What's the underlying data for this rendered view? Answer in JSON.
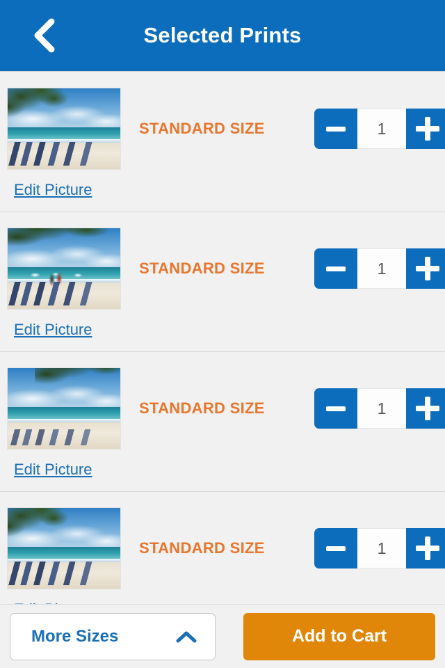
{
  "header": {
    "title": "Selected Prints",
    "back_icon": "chevron-left-icon",
    "background_color": "#0c6dbc"
  },
  "colors": {
    "header_blue": "#0c6dbc",
    "accent_orange": "#e8762c",
    "cart_orange": "#e08609",
    "link_blue": "#1a6fb5",
    "page_background": "#f1f1f1"
  },
  "prints": [
    {
      "size_label": "STANDARD SIZE",
      "quantity": "1",
      "edit_label": "Edit Picture",
      "minus_icon": "minus-icon",
      "plus_icon": "plus-icon",
      "thumbnail_alt": "beach with palm tree shade and blue lounge chairs"
    },
    {
      "size_label": "STANDARD SIZE",
      "quantity": "1",
      "edit_label": "Edit Picture",
      "minus_icon": "minus-icon",
      "plus_icon": "plus-icon",
      "thumbnail_alt": "beach with people, boats and rows of lounge chairs"
    },
    {
      "size_label": "STANDARD SIZE",
      "quantity": "1",
      "edit_label": "Edit Picture",
      "minus_icon": "minus-icon",
      "plus_icon": "plus-icon",
      "thumbnail_alt": "wide white sand beach with scattered chairs"
    },
    {
      "size_label": "STANDARD SIZE",
      "quantity": "1",
      "edit_label": "Edit Picture",
      "minus_icon": "minus-icon",
      "plus_icon": "plus-icon",
      "thumbnail_alt": "beach partially hidden behind bottom bar"
    }
  ],
  "bottom_bar": {
    "more_sizes_label": "More Sizes",
    "more_sizes_icon": "chevron-up-icon",
    "add_to_cart_label": "Add to Cart"
  }
}
